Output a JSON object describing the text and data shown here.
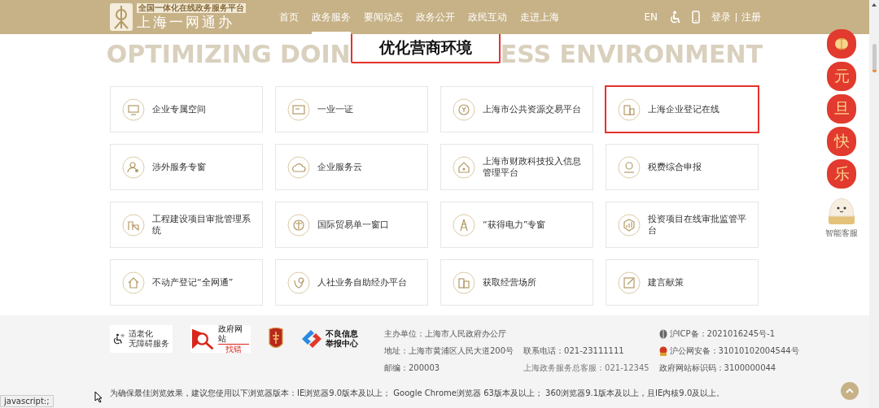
{
  "header": {
    "logo": {
      "tagline": "全国一体化在线政务服务平台",
      "name": "上海一网通办"
    },
    "nav": [
      {
        "label": "首页",
        "selected": false
      },
      {
        "label": "政务服务",
        "selected": true
      },
      {
        "label": "要闻动态",
        "selected": false
      },
      {
        "label": "政务公开",
        "selected": false
      },
      {
        "label": "政民互动",
        "selected": false
      },
      {
        "label": "走进上海",
        "selected": false
      }
    ],
    "language": "EN",
    "login": "登录",
    "register": "注册"
  },
  "section": {
    "background_text_left": "OPTIMIZING DOIN",
    "background_text_right": "ESS ENVIRONMENT",
    "title": "优化营商环境",
    "title_highlighted": true,
    "services": [
      {
        "label": "企业专属空间",
        "highlighted": false
      },
      {
        "label": "一业一证",
        "highlighted": false
      },
      {
        "label": "上海市公共资源交易平台",
        "highlighted": false
      },
      {
        "label": "上海企业登记在线",
        "highlighted": true
      },
      {
        "label": "涉外服务专窗",
        "highlighted": false
      },
      {
        "label": "企业服务云",
        "highlighted": false
      },
      {
        "label": "上海市财政科技投入信息管理平台",
        "highlighted": false
      },
      {
        "label": "税费综合申报",
        "highlighted": false
      },
      {
        "label": "工程建设项目审批管理系统",
        "highlighted": false
      },
      {
        "label": "国际贸易单一窗口",
        "highlighted": false
      },
      {
        "label": "“获得电力”专窗",
        "highlighted": false
      },
      {
        "label": "投资项目在线审批监管平台",
        "highlighted": false
      },
      {
        "label": "不动产登记“全网通”",
        "highlighted": false
      },
      {
        "label": "人社业务自助经办平台",
        "highlighted": false
      },
      {
        "label": "获取经营场所",
        "highlighted": false
      },
      {
        "label": "建言献策",
        "highlighted": false
      }
    ]
  },
  "footer": {
    "badges": [
      {
        "kind": "accessibility",
        "lines": [
          "适老化",
          "无障碍服务"
        ]
      },
      {
        "kind": "error-report",
        "lines": [
          "政府网站",
          "找错"
        ]
      },
      {
        "kind": "emblem"
      },
      {
        "kind": "report-center",
        "lines": [
          "不良信息",
          "举报中心"
        ]
      }
    ],
    "info_columns": [
      {
        "lines": [
          "主办单位：上海市人民政府办公厅",
          "地址：上海市黄浦区人民大道200号",
          "邮编：200003"
        ]
      },
      {
        "lines": [
          "联系电话：021-23111111",
          "上海政务服务总客服：021-12345"
        ]
      },
      {
        "lines": [
          "沪ICP备：2021016245号-1",
          "沪公网安备：31010102004544号",
          "政府网站标识码：3100000044"
        ]
      }
    ],
    "browser_note": "为确保最佳浏览效果，建议您使用以下浏览器版本：IE浏览器9.0版本及以上； Google Chrome浏览器 63版本及以上； 360浏览器9.1版本及以上，且IE内核9.0及以上。"
  },
  "festive": [
    "元",
    "旦",
    "快",
    "乐"
  ],
  "assistant": {
    "label": "智能客服"
  },
  "status_bar": "javascript:;"
}
